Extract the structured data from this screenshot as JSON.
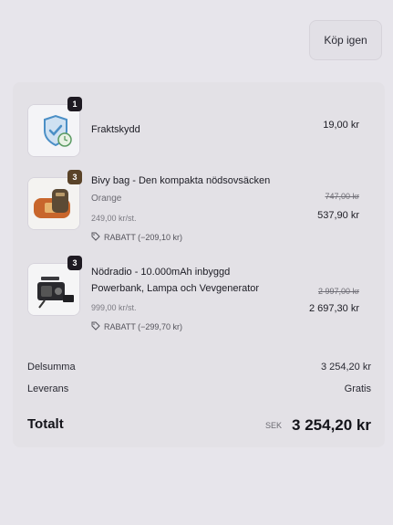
{
  "topbar": {
    "reorder_label": "Köp igen"
  },
  "items": [
    {
      "qty": "1",
      "icon": "shield-clock-icon",
      "title_lines": [
        "Fraktskydd"
      ],
      "price": "19,00 kr"
    },
    {
      "qty": "3",
      "icon": "bivy-bag-icon",
      "title_lines": [
        "Bivy bag - Den kompakta nödsovsäcken"
      ],
      "variant": "Orange",
      "unit_price": "249,00 kr/st.",
      "discount": "RABATT (−209,10 kr)",
      "old_price": "747,00 kr",
      "price": "537,90 kr"
    },
    {
      "qty": "3",
      "icon": "radio-icon",
      "title_lines": [
        "Nödradio - 10.000mAh inbyggd",
        "Powerbank, Lampa och Vevgenerator"
      ],
      "unit_price": "999,00 kr/st.",
      "discount": "RABATT (−299,70 kr)",
      "old_price": "2 997,00 kr",
      "price": "2 697,30 kr"
    }
  ],
  "summary": {
    "subtotal_label": "Delsumma",
    "subtotal_value": "3 254,20 kr",
    "shipping_label": "Leverans",
    "shipping_value": "Gratis",
    "total_label": "Totalt",
    "currency": "SEK",
    "total_value": "3 254,20 kr"
  },
  "colors": {
    "accent_bag": "#c8662c",
    "shield": "#4b8fc6",
    "badge_dark": "#1e1a22"
  }
}
